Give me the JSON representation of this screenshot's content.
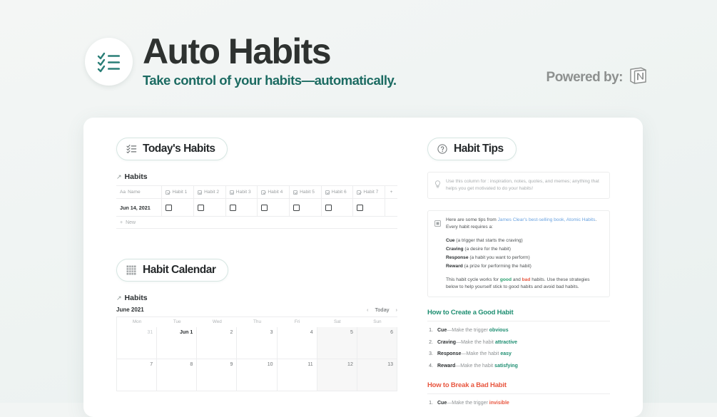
{
  "header": {
    "title": "Auto Habits",
    "tagline": "Take control of your habits—automatically.",
    "powered_by_label": "Powered by:",
    "logo_icon": "checklist-icon",
    "notion_icon": "notion-logo-icon",
    "brand_teal": "#1c6b62",
    "title_color": "#2e3230"
  },
  "left_column": {
    "today_section": {
      "pill_icon": "checklist-icon",
      "pill_label": "Today's Habits",
      "breadcrumb": {
        "arrow": "↗",
        "label": "Habits"
      },
      "table": {
        "columns": [
          {
            "icon": "aa-text-icon",
            "label": "Name"
          },
          {
            "icon": "checkbox-icon",
            "label": "Habit 1"
          },
          {
            "icon": "checkbox-icon",
            "label": "Habit 2"
          },
          {
            "icon": "checkbox-icon",
            "label": "Habit 3"
          },
          {
            "icon": "checkbox-icon",
            "label": "Habit 4"
          },
          {
            "icon": "checkbox-icon",
            "label": "Habit 5"
          },
          {
            "icon": "checkbox-icon",
            "label": "Habit 6"
          },
          {
            "icon": "checkbox-icon",
            "label": "Habit 7"
          }
        ],
        "add_column_label": "+",
        "rows": [
          {
            "name": "Jun 14, 2021",
            "checks": [
              false,
              false,
              false,
              false,
              false,
              false,
              false
            ]
          }
        ],
        "new_row_label": "New",
        "new_row_icon": "plus-icon"
      }
    },
    "calendar_section": {
      "pill_icon": "calendar-grid-icon",
      "pill_label": "Habit Calendar",
      "breadcrumb": {
        "arrow": "↗",
        "label": "Habits"
      },
      "month_label": "June 2021",
      "nav": {
        "prev": "‹",
        "today": "Today",
        "next": "›"
      },
      "weekdays": [
        "Mon",
        "Tue",
        "Wed",
        "Thu",
        "Fri",
        "Sat",
        "Sun"
      ],
      "weeks": [
        [
          {
            "label": "31",
            "muted": true
          },
          {
            "label": "Jun 1",
            "first": true
          },
          {
            "label": "2"
          },
          {
            "label": "3"
          },
          {
            "label": "4"
          },
          {
            "label": "5",
            "weekend": true
          },
          {
            "label": "6",
            "weekend": true
          }
        ],
        [
          {
            "label": "7"
          },
          {
            "label": "8"
          },
          {
            "label": "9"
          },
          {
            "label": "10"
          },
          {
            "label": "11"
          },
          {
            "label": "12",
            "weekend": true
          },
          {
            "label": "13",
            "weekend": true
          }
        ]
      ]
    }
  },
  "right_column": {
    "pill_icon": "question-mark-icon",
    "pill_label": "Habit Tips",
    "callout_tips": {
      "icon": "lightbulb-icon",
      "line1": "Use this column for : inspiration, notes, quotes, and memes;",
      "line2": "anything that helps you get motivated to do your habits!"
    },
    "callout_book": {
      "icon": "book-icon",
      "intro_prefix": "Here are some tips from ",
      "link_text": "James Clear's best-selling book, Atomic Habits",
      "intro_suffix": ". Every habit requires a:",
      "cycle": [
        {
          "term": "Cue",
          "definition": " (a trigger that starts the craving)"
        },
        {
          "term": "Craving",
          "definition": " (a desire for the habit)"
        },
        {
          "term": "Response",
          "definition": " (a habit you want to perform)"
        },
        {
          "term": "Reward",
          "definition": " (a prize for performing the habit)"
        }
      ],
      "closing_1": "This habit cycle works for ",
      "closing_good": "good",
      "closing_2": " and ",
      "closing_bad": "bad",
      "closing_3": " habits. Use these strategies below to help yourself stick to good habits and avoid bad habits."
    },
    "create_section": {
      "title": "How to Create a Good Habit",
      "items": [
        {
          "num": "1.",
          "term": "Cue",
          "text": "—Make the trigger ",
          "keyword": "obvious"
        },
        {
          "num": "2.",
          "term": "Craving",
          "text": "—Make the habit ",
          "keyword": "attractive"
        },
        {
          "num": "3.",
          "term": "Response",
          "text": "—Make the habit ",
          "keyword": "easy"
        },
        {
          "num": "4.",
          "term": "Reward",
          "text": "—Make the habit ",
          "keyword": "satisfying"
        }
      ]
    },
    "break_section": {
      "title": "How to Break a Bad Habit",
      "items": [
        {
          "num": "1.",
          "term": "Cue",
          "text": "—Make the trigger ",
          "keyword": "invisible"
        }
      ]
    }
  }
}
